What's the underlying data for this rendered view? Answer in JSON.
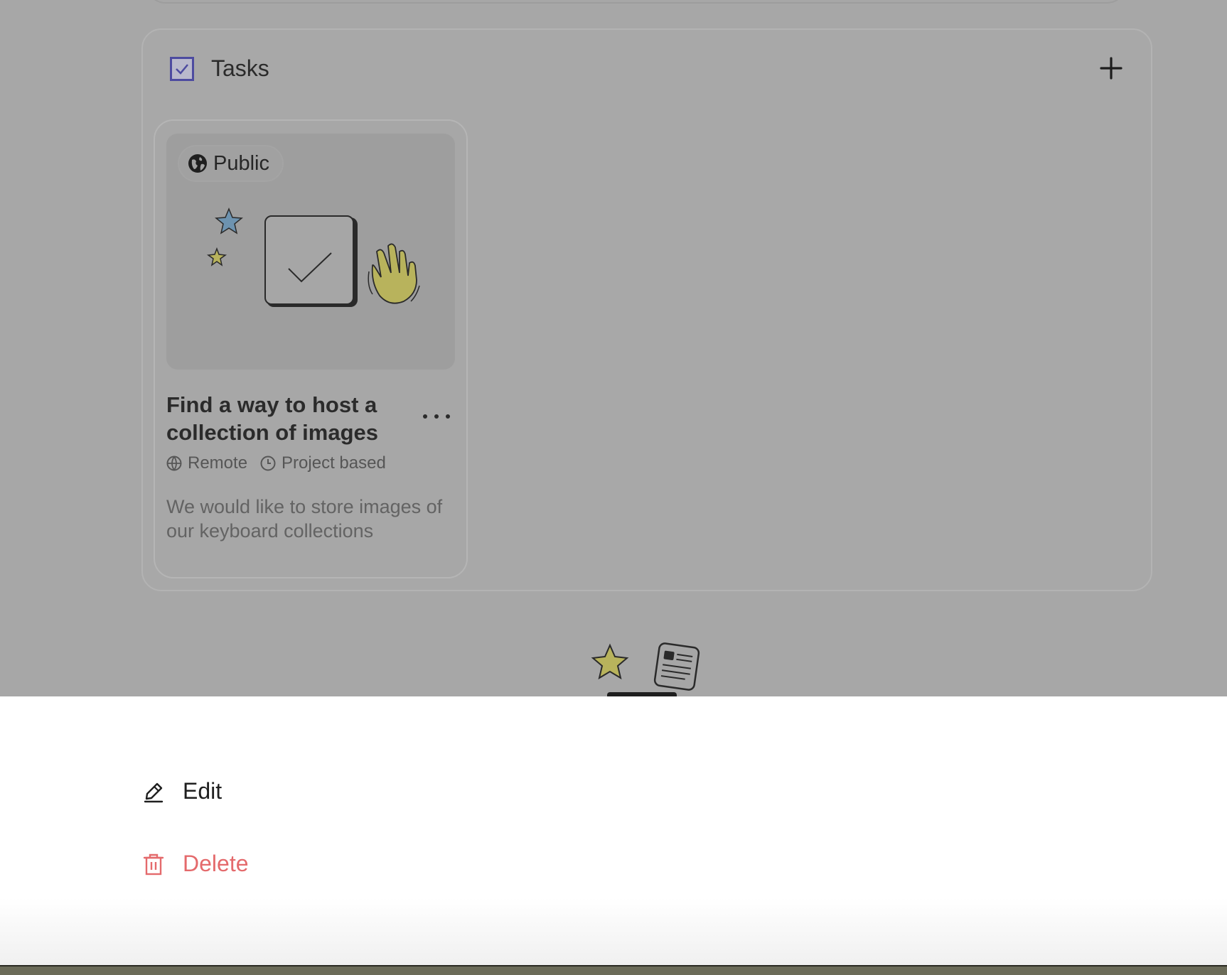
{
  "tasks_section": {
    "title": "Tasks",
    "add_icon": "plus-icon",
    "section_icon": "checkbox-icon"
  },
  "task_card": {
    "visibility_label": "Public",
    "visibility_icon": "globe-icon",
    "title": "Find a way to host a collection of images",
    "location": "Remote",
    "location_icon": "globe-icon",
    "duration": "Project based",
    "duration_icon": "clock-icon",
    "description": "We would like to store images of our keyboard collections",
    "more_icon": "ellipsis-icon"
  },
  "action_sheet": {
    "items": [
      {
        "label": "Edit",
        "icon": "pencil-icon",
        "color": "#1f1f1f"
      },
      {
        "label": "Delete",
        "icon": "trash-icon",
        "color": "#e46a6c"
      }
    ]
  },
  "colors": {
    "overlay": "#a7a7a7",
    "accent": "#4d4ba0",
    "danger": "#e46a6c",
    "star_blue": "#6d93b0",
    "star_olive": "#b8b35c"
  }
}
